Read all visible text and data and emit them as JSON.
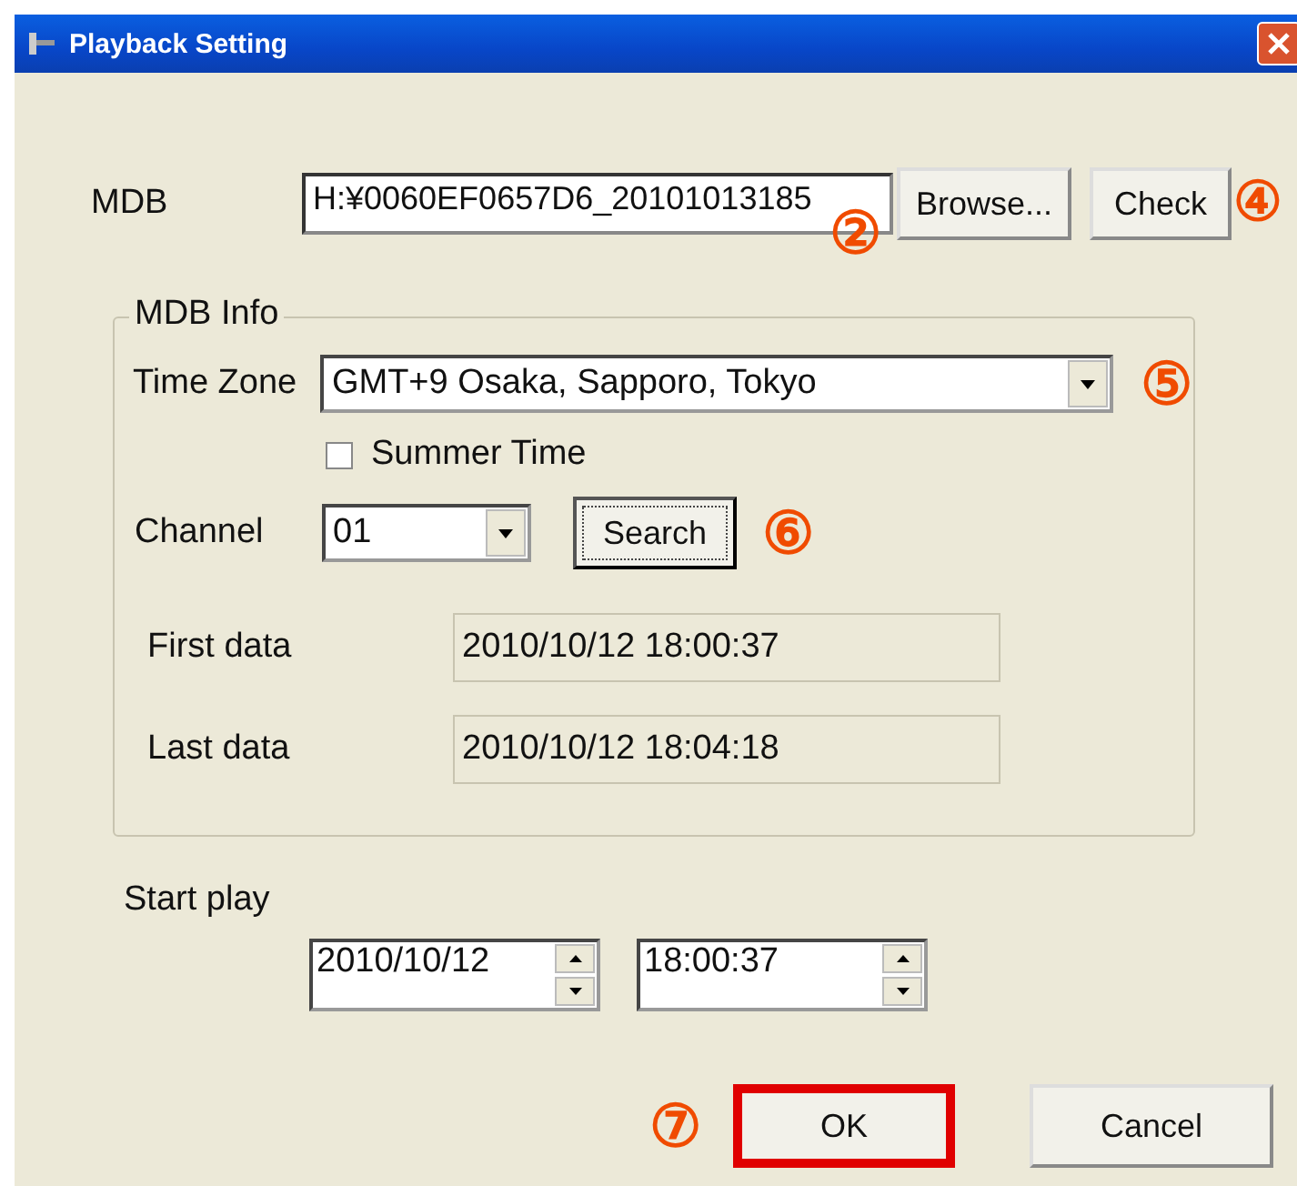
{
  "window": {
    "title": "Playback Setting"
  },
  "mdb": {
    "label": "MDB",
    "value": "H:¥0060EF0657D6_20101013185",
    "callout": "②",
    "buttons": [
      {
        "label": "Browse..."
      },
      {
        "label": "Check",
        "callout": "④"
      }
    ]
  },
  "mdb_info": {
    "title": "MDB Info",
    "time_zone": {
      "label": "Time Zone",
      "value": "GMT+9 Osaka, Sapporo, Tokyo",
      "callout": "⑤"
    },
    "summer_time": {
      "label": "Summer Time",
      "checked": false
    },
    "channel": {
      "label": "Channel",
      "value": "01",
      "button": "Search",
      "callout": "⑥"
    },
    "fields": [
      {
        "label": "First data",
        "value": "2010/10/12 18:00:37"
      },
      {
        "label": "Last data",
        "value": "2010/10/12 18:04:18"
      }
    ]
  },
  "start_play": {
    "label": "Start play",
    "date": "2010/10/12",
    "time": "18:00:37"
  },
  "footer": {
    "callout": "⑦",
    "buttons": [
      {
        "label": "OK",
        "highlighted": true
      },
      {
        "label": "Cancel",
        "highlighted": false
      }
    ]
  }
}
